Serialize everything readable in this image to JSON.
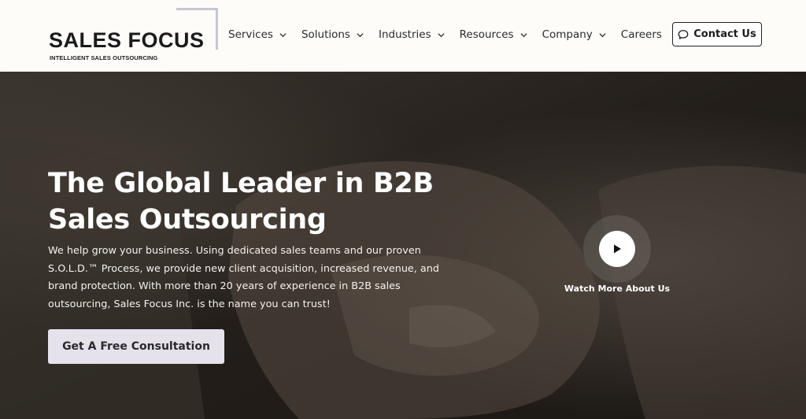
{
  "brand": {
    "name": "SALES FOCUS",
    "tagline": "INTELLIGENT SALES OUTSOURCING"
  },
  "nav": {
    "items": [
      {
        "label": "Services",
        "dropdown": true
      },
      {
        "label": "Solutions",
        "dropdown": true
      },
      {
        "label": "Industries",
        "dropdown": true
      },
      {
        "label": "Resources",
        "dropdown": true
      },
      {
        "label": "Company",
        "dropdown": true
      },
      {
        "label": "Careers",
        "dropdown": false
      }
    ],
    "contact_label": "Contact Us",
    "contact_icon": "chat-bubble-icon"
  },
  "hero": {
    "title_line1": "The Global Leader in B2B",
    "title_line2": "Sales Outsourcing",
    "body_line1": "We help grow your business. Using dedicated sales teams and our proven",
    "body_line2": "S.O.L.D.™ Process, we provide new client acquisition, increased revenue, and",
    "body_line3": "brand protection. With more than 20 years of experience in B2B sales",
    "body_line4": "outsourcing, Sales Focus Inc. is the name you can trust!",
    "cta_label": "Get A Free Consultation",
    "video_label": "Watch More About Us",
    "video_icon": "play-icon"
  },
  "colors": {
    "header_bg": "#fdfcf9",
    "hero_overlay": "#2a241f",
    "cta_bg": "#e6e2ec",
    "text_dark": "#1b1b1b"
  }
}
